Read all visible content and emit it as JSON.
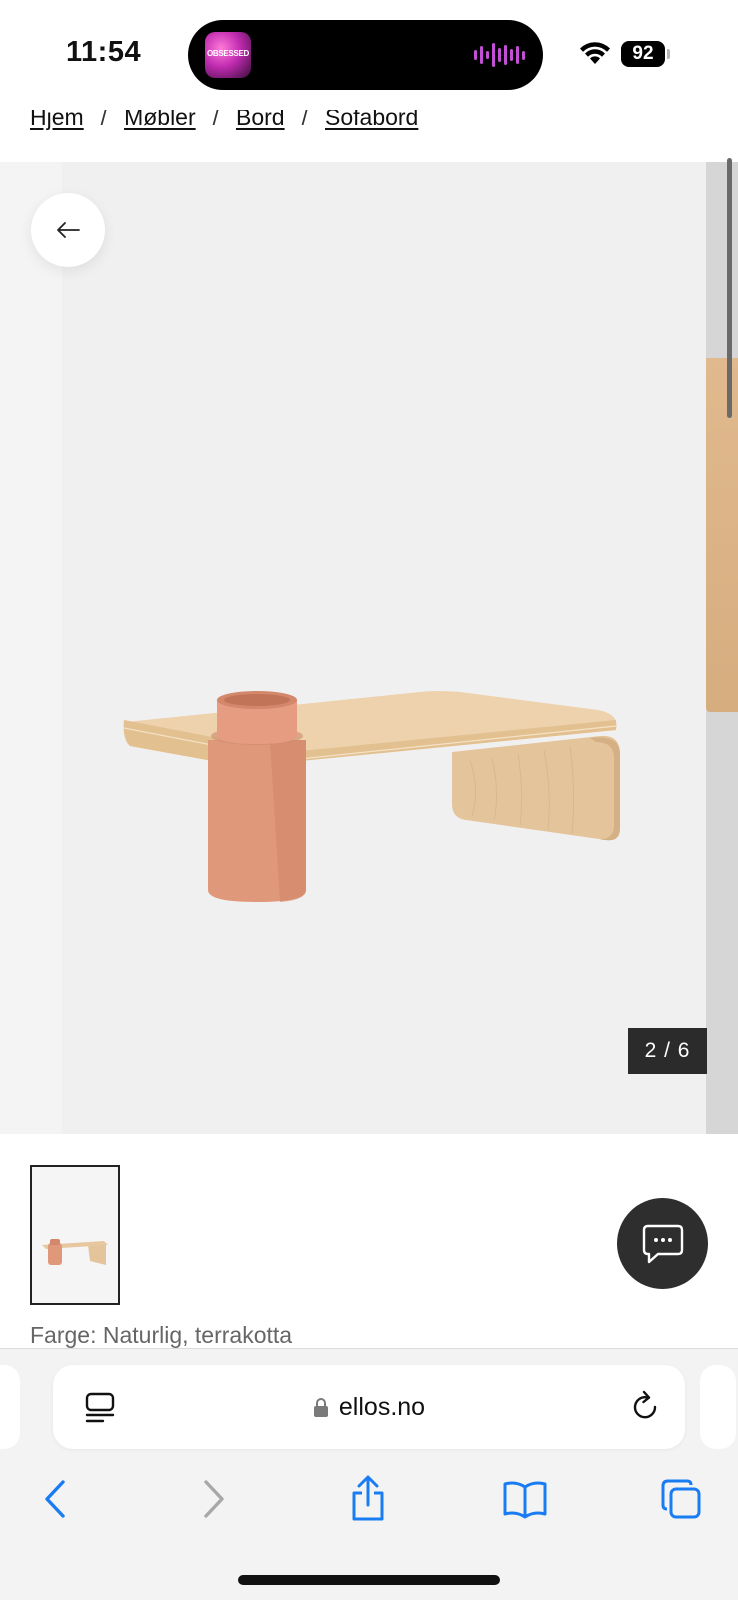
{
  "status_bar": {
    "time": "11:54",
    "battery_level": "92",
    "now_playing_art_text": "OBSESSED",
    "icons": [
      "now-playing-art",
      "audio-waveform-icon",
      "wifi-icon",
      "battery-icon"
    ]
  },
  "breadcrumb": {
    "items": [
      {
        "label": "Hjem"
      },
      {
        "label": "Møbler"
      },
      {
        "label": "Bord"
      },
      {
        "label": "Sofabord"
      }
    ],
    "separator": "/"
  },
  "gallery": {
    "counter": "2 / 6",
    "back_icon": "arrow-left-icon",
    "image_alt": "Sofabord i naturlig tre med terrakotta sylinder"
  },
  "product": {
    "color_label": "Farge: Naturlig, terrakotta"
  },
  "chat": {
    "icon": "chat-bubble-icon"
  },
  "browser": {
    "domain": "ellos.no",
    "icons": [
      "page-menu-icon",
      "lock-icon",
      "reload-icon",
      "back-icon",
      "forward-icon",
      "share-icon",
      "bookmarks-icon",
      "tabs-icon"
    ]
  },
  "colors": {
    "accent_blue": "#1a7cf2",
    "disabled_gray": "#a8a8a8",
    "waveform_purple": "#c24fd6",
    "wood": "#e4c49a",
    "terracotta": "#e0987a"
  }
}
